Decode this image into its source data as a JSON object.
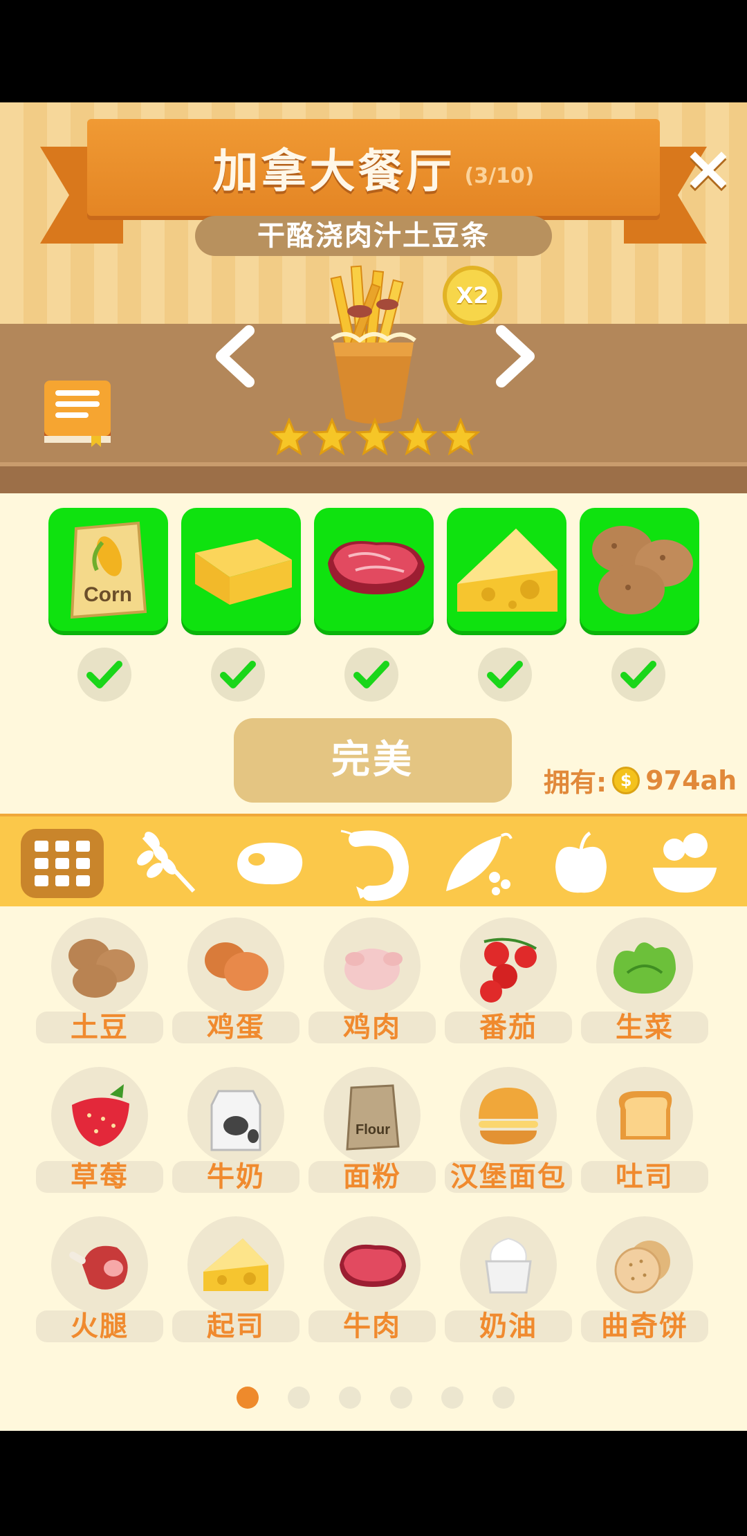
{
  "header": {
    "restaurant_title": "加拿大餐厅",
    "progress": "(3/10)",
    "dish_name": "干酪浇肉汁土豆条",
    "multiplier": "X2",
    "rating_stars": 5
  },
  "colors": {
    "ribbon": "#f09a34",
    "ingredient_ready": "#0fe20f",
    "label_orange": "#f08a2e",
    "tab_bar": "#fbc84a"
  },
  "recipe_ingredients": [
    {
      "name": "corn-bag",
      "text": "Corn"
    },
    {
      "name": "butter"
    },
    {
      "name": "beef"
    },
    {
      "name": "cheese"
    },
    {
      "name": "potatoes"
    }
  ],
  "action": {
    "perfect_label": "完美"
  },
  "wallet": {
    "owned_label": "拥有:",
    "coin_symbol": "$",
    "amount": "974ah"
  },
  "tabs": [
    {
      "name": "all-grid-icon",
      "active": true
    },
    {
      "name": "grain-icon"
    },
    {
      "name": "meat-icon"
    },
    {
      "name": "shrimp-icon"
    },
    {
      "name": "pea-icon"
    },
    {
      "name": "apple-icon"
    },
    {
      "name": "salad-icon"
    }
  ],
  "foods": [
    {
      "label": "土豆",
      "icon": "potato"
    },
    {
      "label": "鸡蛋",
      "icon": "egg"
    },
    {
      "label": "鸡肉",
      "icon": "chicken"
    },
    {
      "label": "番茄",
      "icon": "tomato"
    },
    {
      "label": "生菜",
      "icon": "lettuce"
    },
    {
      "label": "草莓",
      "icon": "strawberry"
    },
    {
      "label": "牛奶",
      "icon": "milk"
    },
    {
      "label": "面粉",
      "icon": "flour",
      "text": "Flour"
    },
    {
      "label": "汉堡面包",
      "icon": "burger-bun"
    },
    {
      "label": "吐司",
      "icon": "toast"
    },
    {
      "label": "火腿",
      "icon": "ham"
    },
    {
      "label": "起司",
      "icon": "cheese"
    },
    {
      "label": "牛肉",
      "icon": "beef"
    },
    {
      "label": "奶油",
      "icon": "cream"
    },
    {
      "label": "曲奇饼",
      "icon": "cookie"
    }
  ],
  "pager": {
    "pages": 6,
    "current": 1
  }
}
